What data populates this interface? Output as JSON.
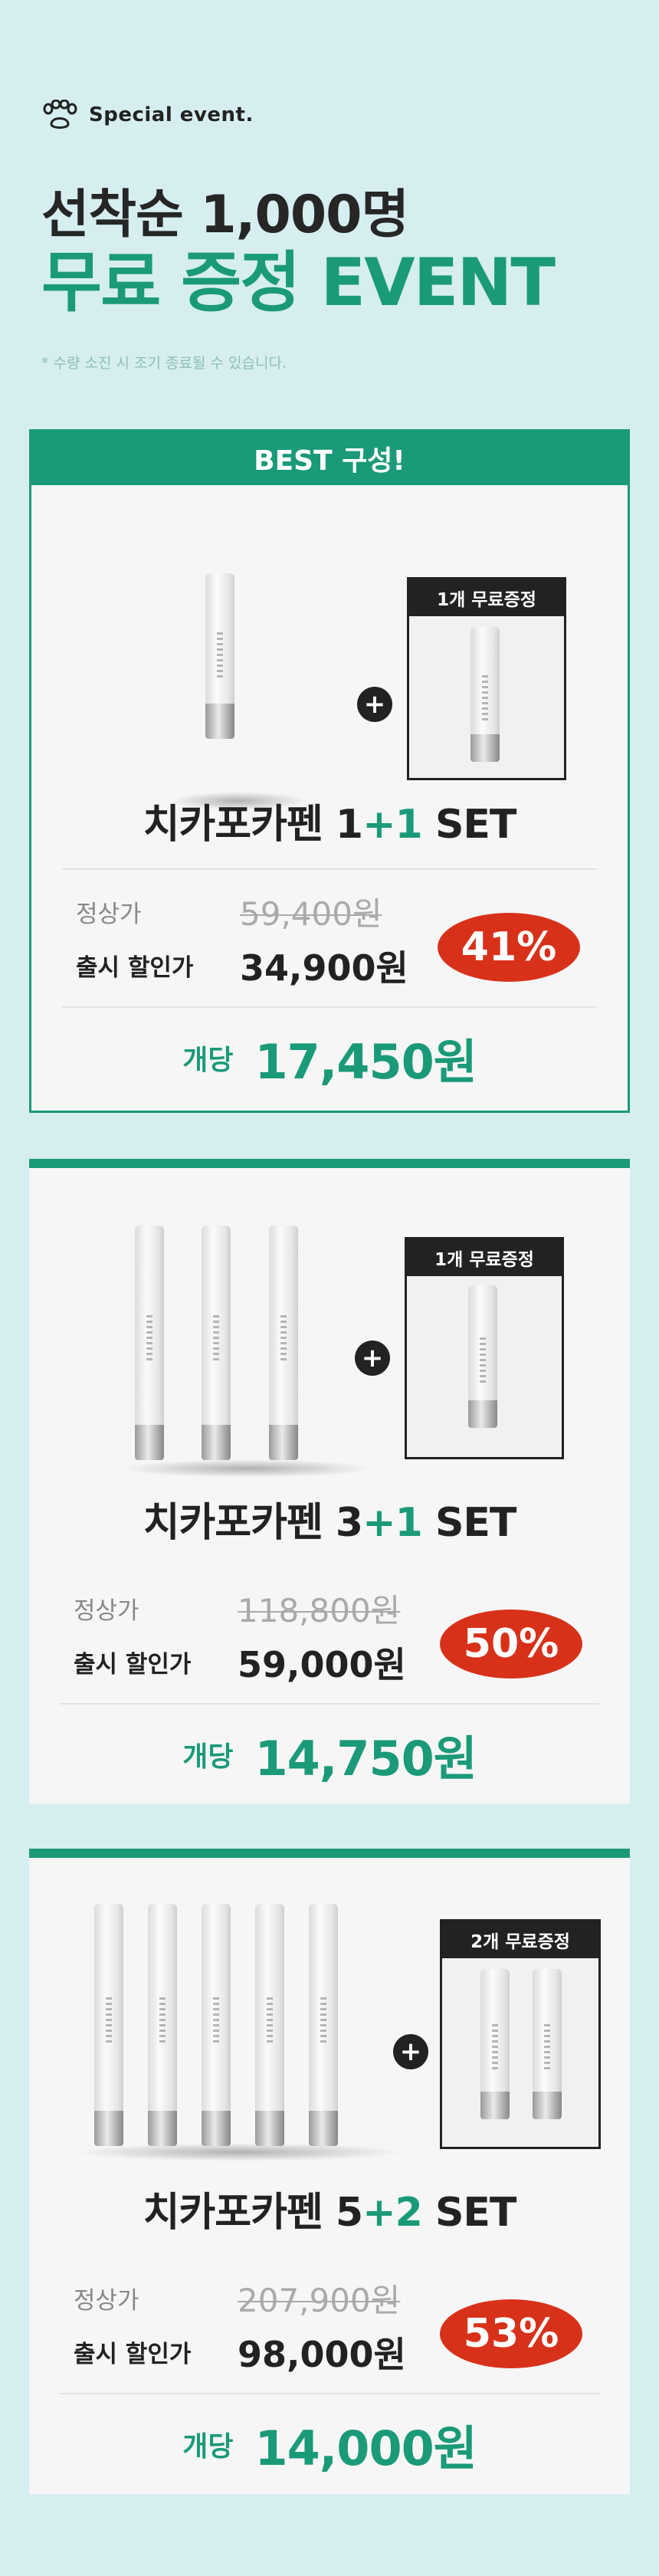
{
  "header": {
    "tag": "Special event.",
    "title_line1": "선착순 1,000명",
    "title_line2": "무료 증정 EVENT",
    "note": "* 수량 소진 시 조기 종료될 수 있습니다."
  },
  "best_label": "BEST 구성!",
  "sets": [
    {
      "gift": "1개 무료증정",
      "name_prefix": "치카포카펜 ",
      "name_a": "1",
      "name_plus": "+1",
      "name_suffix": " SET",
      "regular_label": "정상가",
      "regular_price": "59,400원",
      "sale_label": "출시 할인가",
      "sale_price": "34,900원",
      "discount": "41%",
      "each_label": "개당",
      "each_price": "17,450원"
    },
    {
      "gift": "1개 무료증정",
      "name_prefix": "치카포카펜 ",
      "name_a": "3",
      "name_plus": "+1",
      "name_suffix": " SET",
      "regular_label": "정상가",
      "regular_price": "118,800원",
      "sale_label": "출시 할인가",
      "sale_price": "59,000원",
      "discount": "50%",
      "each_label": "개당",
      "each_price": "14,750원"
    },
    {
      "gift": "2개 무료증정",
      "name_prefix": "치카포카펜 ",
      "name_a": "5",
      "name_plus": "+2",
      "name_suffix": " SET",
      "regular_label": "정상가",
      "regular_price": "207,900원",
      "sale_label": "출시 할인가",
      "sale_price": "98,000원",
      "discount": "53%",
      "each_label": "개당",
      "each_price": "14,000원"
    }
  ],
  "colors": {
    "accent": "#1a9a78",
    "badge": "#d8311a",
    "background": "#d6eeef"
  }
}
